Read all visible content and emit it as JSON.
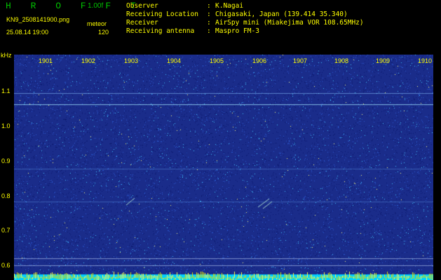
{
  "header": {
    "app_title": "H R O F F T",
    "version": "1.00f",
    "filename": "KN9_2508141900.png",
    "mode": "meteor",
    "timestamp": "25.08.14 19:00",
    "count": "120"
  },
  "info": [
    {
      "key": "Observer",
      "value": "K.Nagai"
    },
    {
      "key": "Receiving Location",
      "value": "Chigasaki, Japan (139.414 35.340)"
    },
    {
      "key": "Receiver",
      "value": "AirSpy mini (Miakejima VOR 108.65MHz)"
    },
    {
      "key": "Receiving antenna",
      "value": "Maspro FM-3"
    }
  ],
  "plot": {
    "y_unit": "kHz",
    "y_labels": [
      "1.1",
      "1.0",
      "0.9",
      "0.8",
      "0.7",
      "0.6"
    ],
    "x_labels": [
      "1901",
      "1902",
      "1903",
      "1904",
      "1905",
      "1906",
      "1907",
      "1908",
      "1909",
      "1910"
    ],
    "colors": {
      "background": "#1a2c8a",
      "signal": "#00ffff",
      "peak": "#ffff00",
      "label": "#ffff00",
      "title": "#00c000"
    }
  }
}
